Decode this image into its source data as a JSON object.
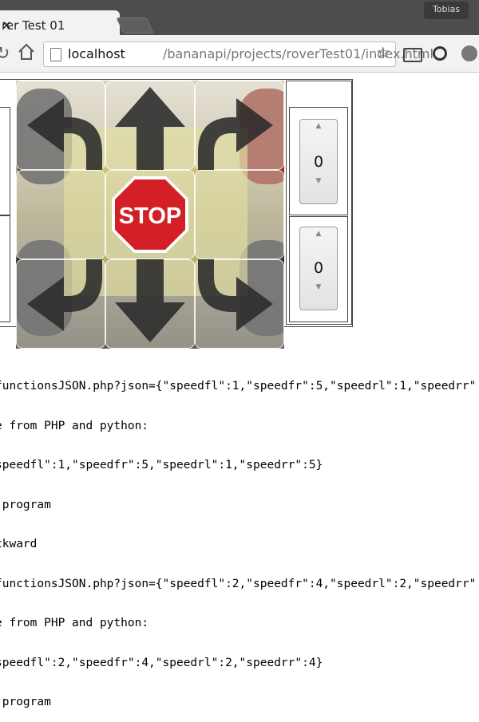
{
  "browser": {
    "tab_title": "rer Test 01",
    "tab_close": "✕",
    "profile_name": "Tobias",
    "url_host": "localhost",
    "url_path": "/bananapi/projects/roverTest01/index.html",
    "icons": [
      "reload-icon",
      "home-icon",
      "page-icon",
      "star-icon",
      "cast-icon",
      "webcam-icon",
      "extension-icon"
    ]
  },
  "controls": {
    "stop_label": "STOP",
    "directions": [
      "forward-left",
      "forward",
      "forward-right",
      "left",
      "stop",
      "right",
      "backward-left",
      "backward",
      "backward-right"
    ],
    "speed_top": {
      "value": "0",
      "up": "▲",
      "down": "▼"
    },
    "speed_bottom": {
      "value": "0",
      "up": "▲",
      "down": "▼"
    }
  },
  "console": {
    "lines": [
      "functionsJSON.php?json={\"speedfl\":1,\"speedfr\":5,\"speedrl\":1,\"speedrr\"",
      "e from PHP and python:",
      "speedfl\":1,\"speedfr\":5,\"speedrl\":1,\"speedrr\":5}",
      " program",
      "ckward",
      "functionsJSON.php?json={\"speedfl\":2,\"speedfr\":4,\"speedrl\":2,\"speedrr\"",
      "e from PHP and python:",
      "speedfl\":2,\"speedfr\":4,\"speedrl\":2,\"speedrr\":4}",
      " program"
    ]
  },
  "colors": {
    "stop_red": "#d32027",
    "arrow_dark": "#2a2a2a",
    "tab_bar": "#4d4d4d"
  }
}
